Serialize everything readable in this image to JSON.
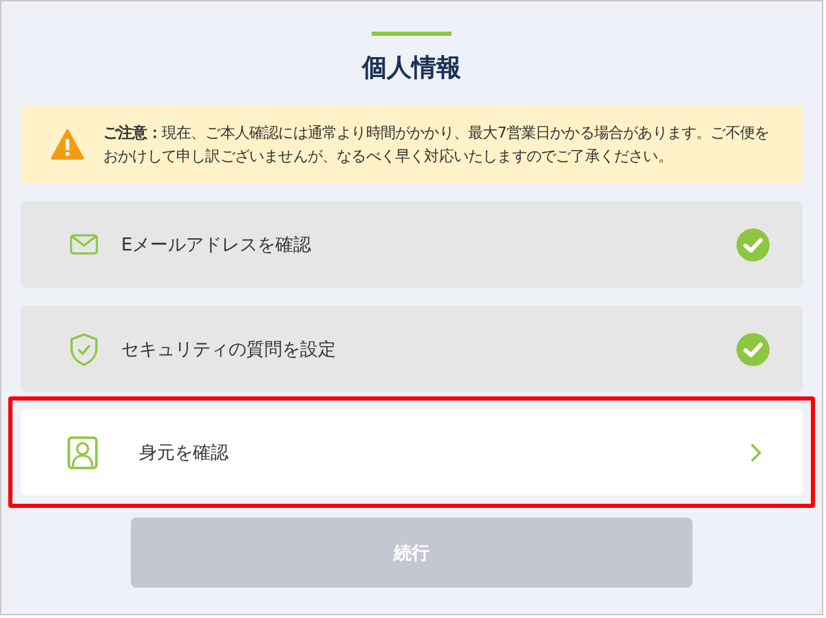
{
  "title": "個人情報",
  "notice": {
    "text": "**ご注意：**現在、ご本人確認には通常より時間がかかり、最大7営業日かかる場合があります。ご不便をおかけして申し訳ございませんが、なるべく早く対応いたしますのでご了承ください。"
  },
  "steps": [
    {
      "kind": "email",
      "label": "Eメールアドレスを確認",
      "done": true,
      "highlighted": false
    },
    {
      "kind": "shield",
      "label": "セキュリティの質問を設定",
      "done": true,
      "highlighted": false
    },
    {
      "kind": "person",
      "label": "身元を確認",
      "done": false,
      "highlighted": true
    }
  ],
  "continue_button": {
    "label": "続行",
    "disabled": true
  }
}
